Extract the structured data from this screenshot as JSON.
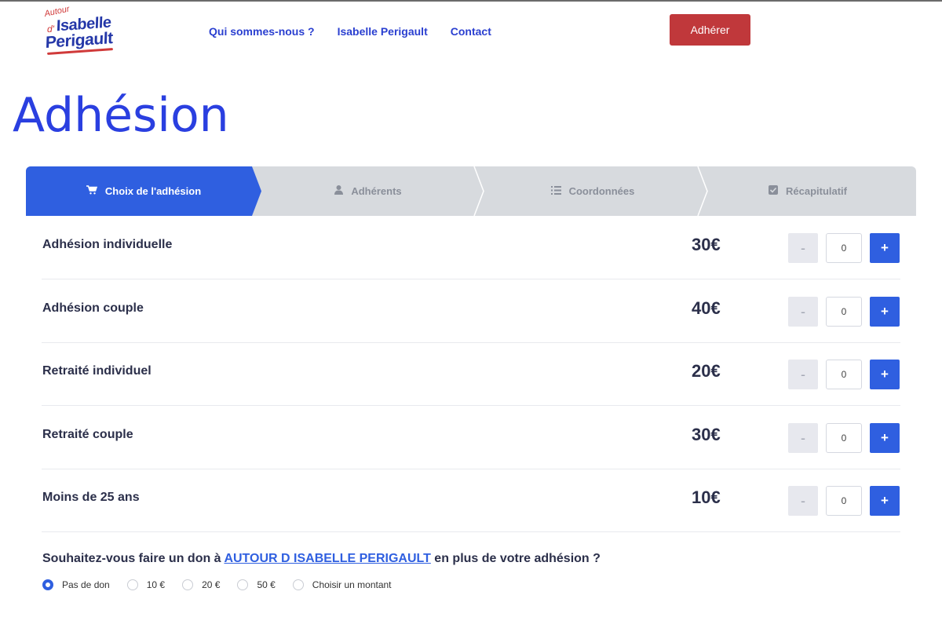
{
  "header": {
    "logo": {
      "line_top": "Autour",
      "line_d": "d'",
      "line1": "Isabelle",
      "line2": "Perigault"
    },
    "nav": [
      "Qui sommes-nous ?",
      "Isabelle Perigault",
      "Contact"
    ],
    "join_label": "Adhérer"
  },
  "page_title": "Adhésion",
  "steps": [
    {
      "label": "Choix de l'adhésion",
      "icon": "cart-icon",
      "active": true
    },
    {
      "label": "Adhérents",
      "icon": "user-icon",
      "active": false
    },
    {
      "label": "Coordonnées",
      "icon": "list-icon",
      "active": false
    },
    {
      "label": "Récapitulatif",
      "icon": "checkbox-icon",
      "active": false
    }
  ],
  "memberships": [
    {
      "name": "Adhésion individuelle",
      "price": "30€",
      "qty": "0"
    },
    {
      "name": "Adhésion couple",
      "price": "40€",
      "qty": "0"
    },
    {
      "name": "Retraité individuel",
      "price": "20€",
      "qty": "0"
    },
    {
      "name": "Retraité couple",
      "price": "30€",
      "qty": "0"
    },
    {
      "name": "Moins de 25 ans",
      "price": "10€",
      "qty": "0"
    }
  ],
  "stepper_labels": {
    "minus": "-",
    "plus": "+"
  },
  "donation": {
    "question_before": "Souhaitez-vous faire un don à ",
    "org_link": "AUTOUR D ISABELLE PERIGAULT",
    "question_after": " en plus de votre adhésion ?",
    "options": [
      {
        "label": "Pas de don",
        "checked": true
      },
      {
        "label": "10 €",
        "checked": false
      },
      {
        "label": "20 €",
        "checked": false
      },
      {
        "label": "50 €",
        "checked": false
      },
      {
        "label": "Choisir un montant",
        "checked": false
      }
    ]
  },
  "colors": {
    "primary": "#2f5fe0",
    "title": "#2a3fe0",
    "join": "#c0383b",
    "brand_red": "#d03a3a",
    "brand_blue": "#2437a8"
  }
}
